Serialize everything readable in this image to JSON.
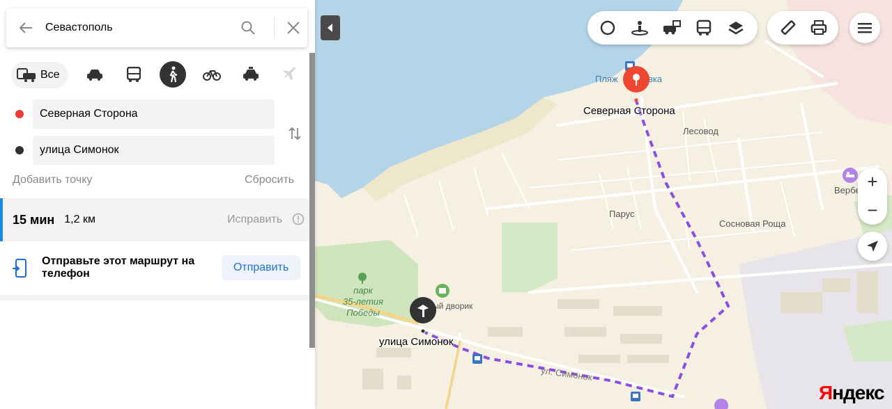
{
  "search": {
    "value": "Севастополь",
    "back_icon": "arrow-left-icon",
    "search_icon": "search-icon",
    "close_icon": "close-icon"
  },
  "transport_modes": {
    "all_label": "Все",
    "items": [
      {
        "name": "car-icon"
      },
      {
        "name": "bus-icon"
      },
      {
        "name": "pedestrian-icon",
        "active": true
      },
      {
        "name": "bicycle-icon"
      },
      {
        "name": "taxi-icon"
      },
      {
        "name": "plane-icon",
        "disabled": true
      }
    ]
  },
  "route_points": {
    "from": {
      "value": "Северная Сторона",
      "color": "#ed3b33"
    },
    "to": {
      "value": "улица Симонок",
      "color": "#333333"
    }
  },
  "actions": {
    "add_point": "Добавить точку",
    "reset": "Сбросить"
  },
  "route": {
    "time": "15 мин",
    "distance": "1,2 км",
    "fix_label": "Исправить",
    "accent": "#1e88e5"
  },
  "send": {
    "text": "Отправьте этот маршрут на телефон",
    "button": "Отправить",
    "button_color": "#1d6fd2"
  },
  "map": {
    "labels": {
      "beach": "Пляж",
      "beach_suffix": "вка",
      "start": "Северная Сторона",
      "lesovod": "Лесовод",
      "verbe": "Вербе",
      "parus": "Парус",
      "sosnovaya": "Сосновая Роща",
      "park": "парк 35-летия Победы",
      "park_l1": "парк",
      "park_l2": "35-летия",
      "park_l3": "Победы",
      "dvorik": "ый дворик",
      "end": "улица Симонок",
      "street": "ул. Симонок"
    },
    "route_color": "#8a4fe0",
    "water_color": "#b4d4e8",
    "controls": [
      "ring-icon",
      "panorama-icon",
      "traffic-camera-icon",
      "public-transport-icon",
      "layers-icon",
      "ruler-icon",
      "print-icon",
      "menu-icon"
    ],
    "zoom_in": "+",
    "zoom_out": "−",
    "logo_y": "Я",
    "logo_rest": "ндекс"
  }
}
